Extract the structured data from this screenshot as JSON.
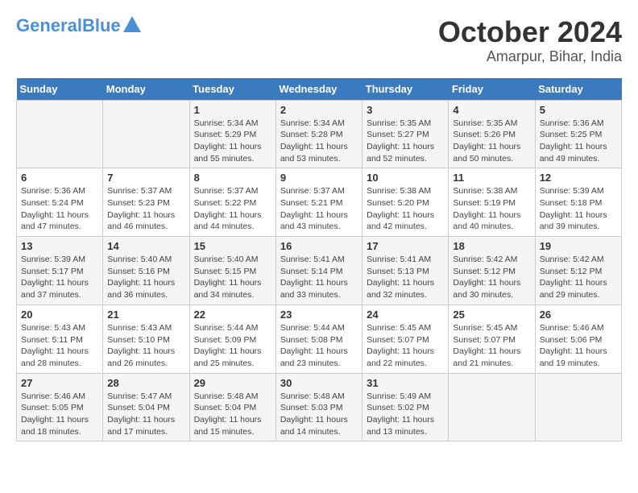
{
  "header": {
    "logo_line1": "General",
    "logo_line2": "Blue",
    "title": "October 2024",
    "subtitle": "Amarpur, Bihar, India"
  },
  "calendar": {
    "days_of_week": [
      "Sunday",
      "Monday",
      "Tuesday",
      "Wednesday",
      "Thursday",
      "Friday",
      "Saturday"
    ],
    "weeks": [
      [
        {
          "day": "",
          "info": ""
        },
        {
          "day": "",
          "info": ""
        },
        {
          "day": "1",
          "info": "Sunrise: 5:34 AM\nSunset: 5:29 PM\nDaylight: 11 hours and 55 minutes."
        },
        {
          "day": "2",
          "info": "Sunrise: 5:34 AM\nSunset: 5:28 PM\nDaylight: 11 hours and 53 minutes."
        },
        {
          "day": "3",
          "info": "Sunrise: 5:35 AM\nSunset: 5:27 PM\nDaylight: 11 hours and 52 minutes."
        },
        {
          "day": "4",
          "info": "Sunrise: 5:35 AM\nSunset: 5:26 PM\nDaylight: 11 hours and 50 minutes."
        },
        {
          "day": "5",
          "info": "Sunrise: 5:36 AM\nSunset: 5:25 PM\nDaylight: 11 hours and 49 minutes."
        }
      ],
      [
        {
          "day": "6",
          "info": "Sunrise: 5:36 AM\nSunset: 5:24 PM\nDaylight: 11 hours and 47 minutes."
        },
        {
          "day": "7",
          "info": "Sunrise: 5:37 AM\nSunset: 5:23 PM\nDaylight: 11 hours and 46 minutes."
        },
        {
          "day": "8",
          "info": "Sunrise: 5:37 AM\nSunset: 5:22 PM\nDaylight: 11 hours and 44 minutes."
        },
        {
          "day": "9",
          "info": "Sunrise: 5:37 AM\nSunset: 5:21 PM\nDaylight: 11 hours and 43 minutes."
        },
        {
          "day": "10",
          "info": "Sunrise: 5:38 AM\nSunset: 5:20 PM\nDaylight: 11 hours and 42 minutes."
        },
        {
          "day": "11",
          "info": "Sunrise: 5:38 AM\nSunset: 5:19 PM\nDaylight: 11 hours and 40 minutes."
        },
        {
          "day": "12",
          "info": "Sunrise: 5:39 AM\nSunset: 5:18 PM\nDaylight: 11 hours and 39 minutes."
        }
      ],
      [
        {
          "day": "13",
          "info": "Sunrise: 5:39 AM\nSunset: 5:17 PM\nDaylight: 11 hours and 37 minutes."
        },
        {
          "day": "14",
          "info": "Sunrise: 5:40 AM\nSunset: 5:16 PM\nDaylight: 11 hours and 36 minutes."
        },
        {
          "day": "15",
          "info": "Sunrise: 5:40 AM\nSunset: 5:15 PM\nDaylight: 11 hours and 34 minutes."
        },
        {
          "day": "16",
          "info": "Sunrise: 5:41 AM\nSunset: 5:14 PM\nDaylight: 11 hours and 33 minutes."
        },
        {
          "day": "17",
          "info": "Sunrise: 5:41 AM\nSunset: 5:13 PM\nDaylight: 11 hours and 32 minutes."
        },
        {
          "day": "18",
          "info": "Sunrise: 5:42 AM\nSunset: 5:12 PM\nDaylight: 11 hours and 30 minutes."
        },
        {
          "day": "19",
          "info": "Sunrise: 5:42 AM\nSunset: 5:12 PM\nDaylight: 11 hours and 29 minutes."
        }
      ],
      [
        {
          "day": "20",
          "info": "Sunrise: 5:43 AM\nSunset: 5:11 PM\nDaylight: 11 hours and 28 minutes."
        },
        {
          "day": "21",
          "info": "Sunrise: 5:43 AM\nSunset: 5:10 PM\nDaylight: 11 hours and 26 minutes."
        },
        {
          "day": "22",
          "info": "Sunrise: 5:44 AM\nSunset: 5:09 PM\nDaylight: 11 hours and 25 minutes."
        },
        {
          "day": "23",
          "info": "Sunrise: 5:44 AM\nSunset: 5:08 PM\nDaylight: 11 hours and 23 minutes."
        },
        {
          "day": "24",
          "info": "Sunrise: 5:45 AM\nSunset: 5:07 PM\nDaylight: 11 hours and 22 minutes."
        },
        {
          "day": "25",
          "info": "Sunrise: 5:45 AM\nSunset: 5:07 PM\nDaylight: 11 hours and 21 minutes."
        },
        {
          "day": "26",
          "info": "Sunrise: 5:46 AM\nSunset: 5:06 PM\nDaylight: 11 hours and 19 minutes."
        }
      ],
      [
        {
          "day": "27",
          "info": "Sunrise: 5:46 AM\nSunset: 5:05 PM\nDaylight: 11 hours and 18 minutes."
        },
        {
          "day": "28",
          "info": "Sunrise: 5:47 AM\nSunset: 5:04 PM\nDaylight: 11 hours and 17 minutes."
        },
        {
          "day": "29",
          "info": "Sunrise: 5:48 AM\nSunset: 5:04 PM\nDaylight: 11 hours and 15 minutes."
        },
        {
          "day": "30",
          "info": "Sunrise: 5:48 AM\nSunset: 5:03 PM\nDaylight: 11 hours and 14 minutes."
        },
        {
          "day": "31",
          "info": "Sunrise: 5:49 AM\nSunset: 5:02 PM\nDaylight: 11 hours and 13 minutes."
        },
        {
          "day": "",
          "info": ""
        },
        {
          "day": "",
          "info": ""
        }
      ]
    ]
  }
}
